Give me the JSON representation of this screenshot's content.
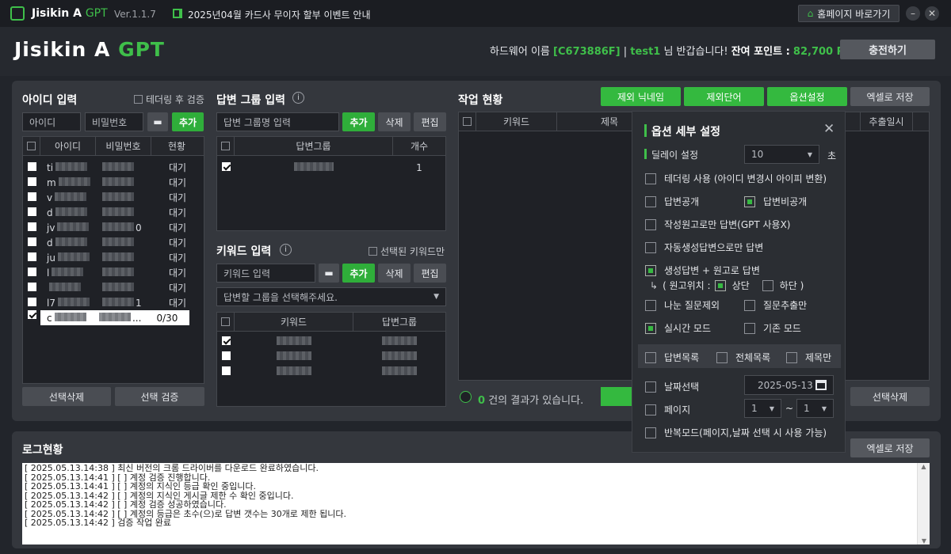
{
  "titlebar": {
    "app": "Jisikin A",
    "app_accent": "GPT",
    "version": "Ver.1.1.7",
    "notice": "2025년04월 카드사 무이자 할부 이벤트 안내",
    "homepage": "홈페이지 바로가기"
  },
  "header": {
    "logo_main": "Jisikin A",
    "logo_accent": "GPT",
    "hw_label": "하드웨어 이름",
    "hw_id": "[C673886F]",
    "sep": "|",
    "user": "test1",
    "greeting": "님 반갑습니다!",
    "points_label": "잔여 포인트 :",
    "points": "82,700 P",
    "charge": "충전하기"
  },
  "id_panel": {
    "title": "아이디 입력",
    "tether_check": "테더링 후 검증",
    "id_placeholder": "아이디",
    "pw_placeholder": "비밀번호",
    "add": "추가",
    "cols": [
      "아이디",
      "비밀번호",
      "현황"
    ],
    "rows": [
      {
        "id": "ti",
        "pw": "",
        "st": "대기"
      },
      {
        "id": "m",
        "pw": "",
        "st": "대기"
      },
      {
        "id": "v",
        "pw": "",
        "st": "대기"
      },
      {
        "id": "d",
        "pw": "",
        "st": "대기"
      },
      {
        "id": "jv",
        "pw": "0",
        "st": "대기"
      },
      {
        "id": "d",
        "pw": "",
        "st": "대기"
      },
      {
        "id": "ju",
        "pw": "",
        "st": "대기"
      },
      {
        "id": "l",
        "pw": "",
        "st": "대기"
      },
      {
        "id": "",
        "pw": "",
        "st": "대기"
      },
      {
        "id": "l7",
        "pw": "1",
        "st": "대기"
      },
      {
        "id": "c",
        "pw": "...",
        "st": "0/30"
      }
    ],
    "del": "선택삭제",
    "verify": "선택 검증"
  },
  "group_panel": {
    "title": "답변 그룹 입력",
    "placeholder": "답변 그룹명 입력",
    "add": "추가",
    "del": "삭제",
    "edit": "편집",
    "cols": [
      "답변그룹",
      "개수"
    ],
    "rows": [
      {
        "count": "1"
      }
    ]
  },
  "keyword_panel": {
    "title": "키워드 입력",
    "only_selected": "선택된 키워드만",
    "placeholder": "키워드 입력",
    "add": "추가",
    "del": "삭제",
    "edit": "편집",
    "select": "답변할 그룹을 선택해주세요.",
    "cols": [
      "키워드",
      "답변그룹"
    ]
  },
  "work_panel": {
    "title": "작업 현황",
    "btn_nick": "제외 닉네임",
    "btn_word": "제외단어",
    "btn_opt": "옵션설정",
    "btn_excel": "엑셀로 저장",
    "cols": [
      "키워드",
      "제목",
      "추출일시"
    ],
    "result_count": "0",
    "result_text": "건의 결과가 있습니다.",
    "del": "선택삭제"
  },
  "options": {
    "title": "옵션 세부 설정",
    "delay_label": "딜레이 설정",
    "delay_value": "10",
    "delay_unit": "초",
    "tether": "테더링 사용 (아이디 변경시 아이피 변환)",
    "public": "답변공개",
    "private": "답변비공개",
    "own_only": "작성원고로만 답변(GPT 사용X)",
    "auto_only": "자동생성답변으로만 답변",
    "gen_plus": "생성답변 + 원고로 답변",
    "pos_label": "( 원고위치 :",
    "pos_top": "상단",
    "pos_bottom": "하단 )",
    "no_nanum": "나눈 질문제외",
    "extract_only": "질문추출만",
    "realtime": "실시간 모드",
    "normal": "기존 모드",
    "list_ans": "답변목록",
    "list_all": "전체목록",
    "title_only": "제목만",
    "date_sel": "날짜선택",
    "date_value": "2025-05-13",
    "page": "페이지",
    "page_from": "1",
    "tilde": "~",
    "page_to": "1",
    "repeat": "반복모드(페이지,날짜 선택 시 사용 가능)"
  },
  "log_panel": {
    "title": "로그현황",
    "excel": "엑셀로 저장",
    "lines": [
      "[ 2025.05.13.14:38 ] 최신 버전의 크롬 드라이버를 다운로드 완료하였습니다.",
      "[ 2025.05.13.14:41 ] [        ] 계정 검증 진행합니다.",
      "[ 2025.05.13.14:41 ] [        ] 계정의 지식인 등급 확인 중입니다.",
      "[ 2025.05.13.14:42 ] [        ] 계정의 지식인 게시글 제한 수 확인 중입니다.",
      "[ 2025.05.13.14:42 ] [        ] 계정 검증 성공하였습니다.",
      "[ 2025.05.13.14:42 ] [        ] 계정의 등급은 초수(으)로 답변 갯수는 30개로 제한 됩니다.",
      "[ 2025.05.13.14:42 ] 검증 작업 완료"
    ]
  },
  "colors": {
    "accent": "#2fae3a",
    "panel": "#34373d"
  }
}
